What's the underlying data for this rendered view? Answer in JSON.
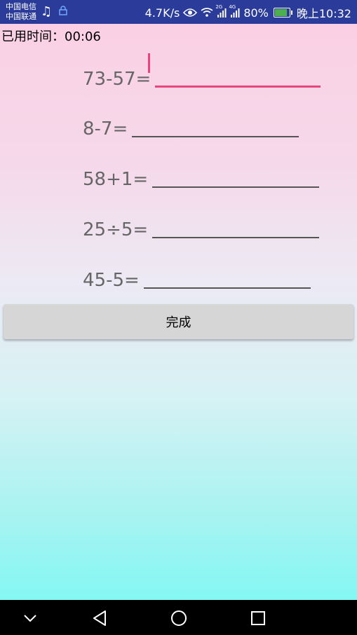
{
  "statusbar": {
    "carrier1": "中国电信",
    "carrier2": "中国联通",
    "speed": "4.7K/s",
    "net1": "2G",
    "net2": "4G",
    "battery": "80%",
    "battery_level": 0.8,
    "time": "晚上10:32"
  },
  "app": {
    "timer_label": "已用时间：",
    "timer_value": "00:06",
    "problems": [
      {
        "expr": "73-57="
      },
      {
        "expr": "8-7="
      },
      {
        "expr": "58+1="
      },
      {
        "expr": "25÷5="
      },
      {
        "expr": "45-5="
      }
    ],
    "done_label": "完成"
  },
  "colors": {
    "accent": "#e8457c",
    "statusbar": "#2a3b9a",
    "button": "#d6d6d6"
  }
}
